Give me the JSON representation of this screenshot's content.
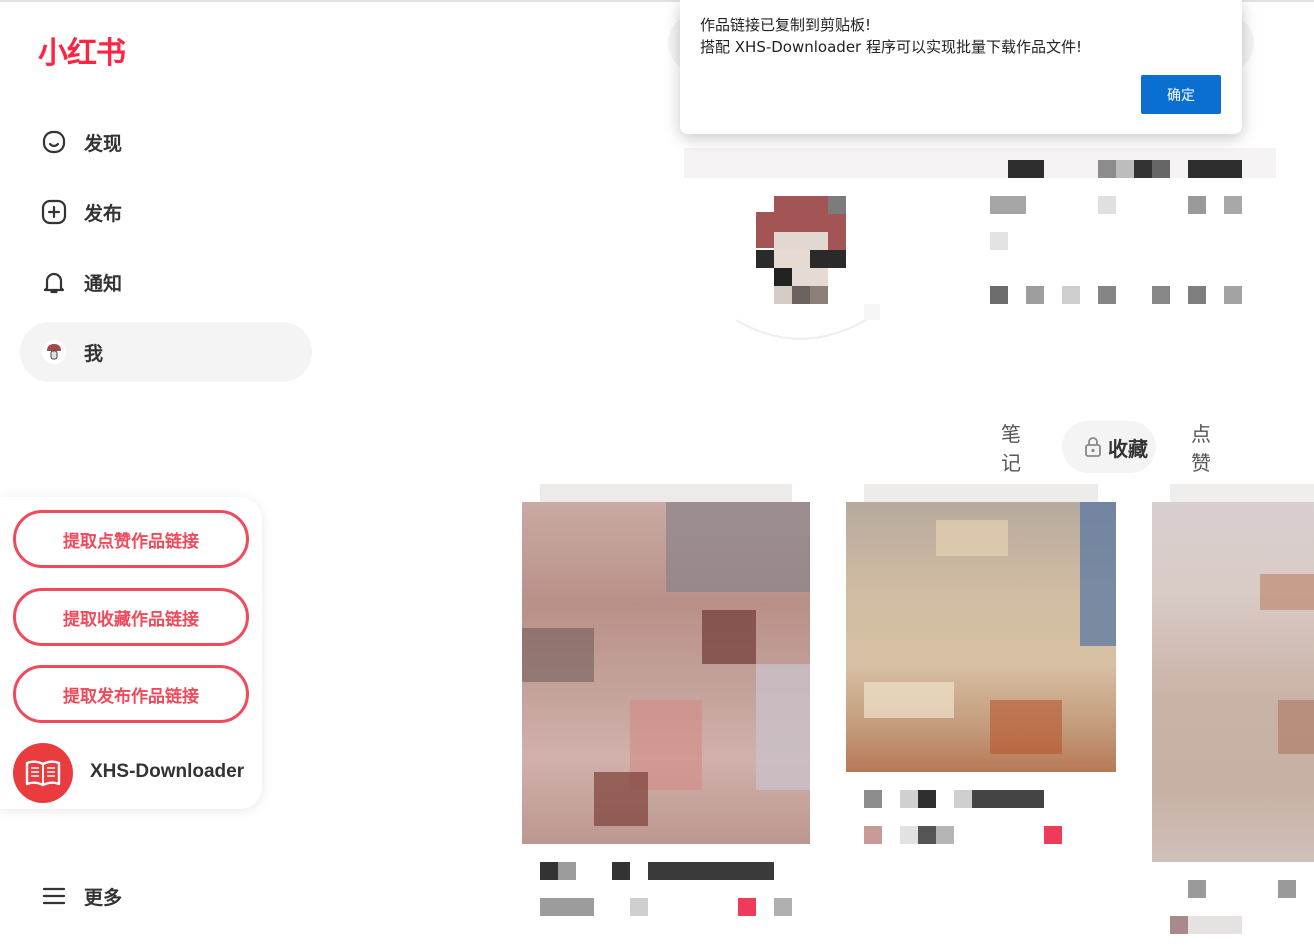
{
  "brand": {
    "logo_text": "小红书",
    "color": "#ff2442"
  },
  "sidebar": {
    "items": [
      {
        "label": "发现",
        "icon": "discover-icon"
      },
      {
        "label": "发布",
        "icon": "plus-square-icon"
      },
      {
        "label": "通知",
        "icon": "bell-icon"
      },
      {
        "label": "我",
        "icon": "avatar-icon",
        "active": true
      }
    ],
    "more_label": "更多",
    "more_icon": "menu-icon"
  },
  "extension": {
    "buttons": [
      {
        "label": "提取点赞作品链接"
      },
      {
        "label": "提取收藏作品链接"
      },
      {
        "label": "提取发布作品链接"
      }
    ],
    "app_name": "XHS-Downloader",
    "app_icon": "book-icon",
    "accent": "#f04a5b"
  },
  "profile": {
    "tabs": [
      {
        "label": "笔记"
      },
      {
        "label": "收藏",
        "active": true,
        "icon": "lock-icon"
      },
      {
        "label": "点赞"
      }
    ]
  },
  "dialog": {
    "line1": "作品链接已复制到剪贴板!",
    "line2": "搭配 XHS-Downloader 程序可以实现批量下载作品文件!",
    "ok_label": "确定",
    "ok_color": "#0b6fd2"
  }
}
